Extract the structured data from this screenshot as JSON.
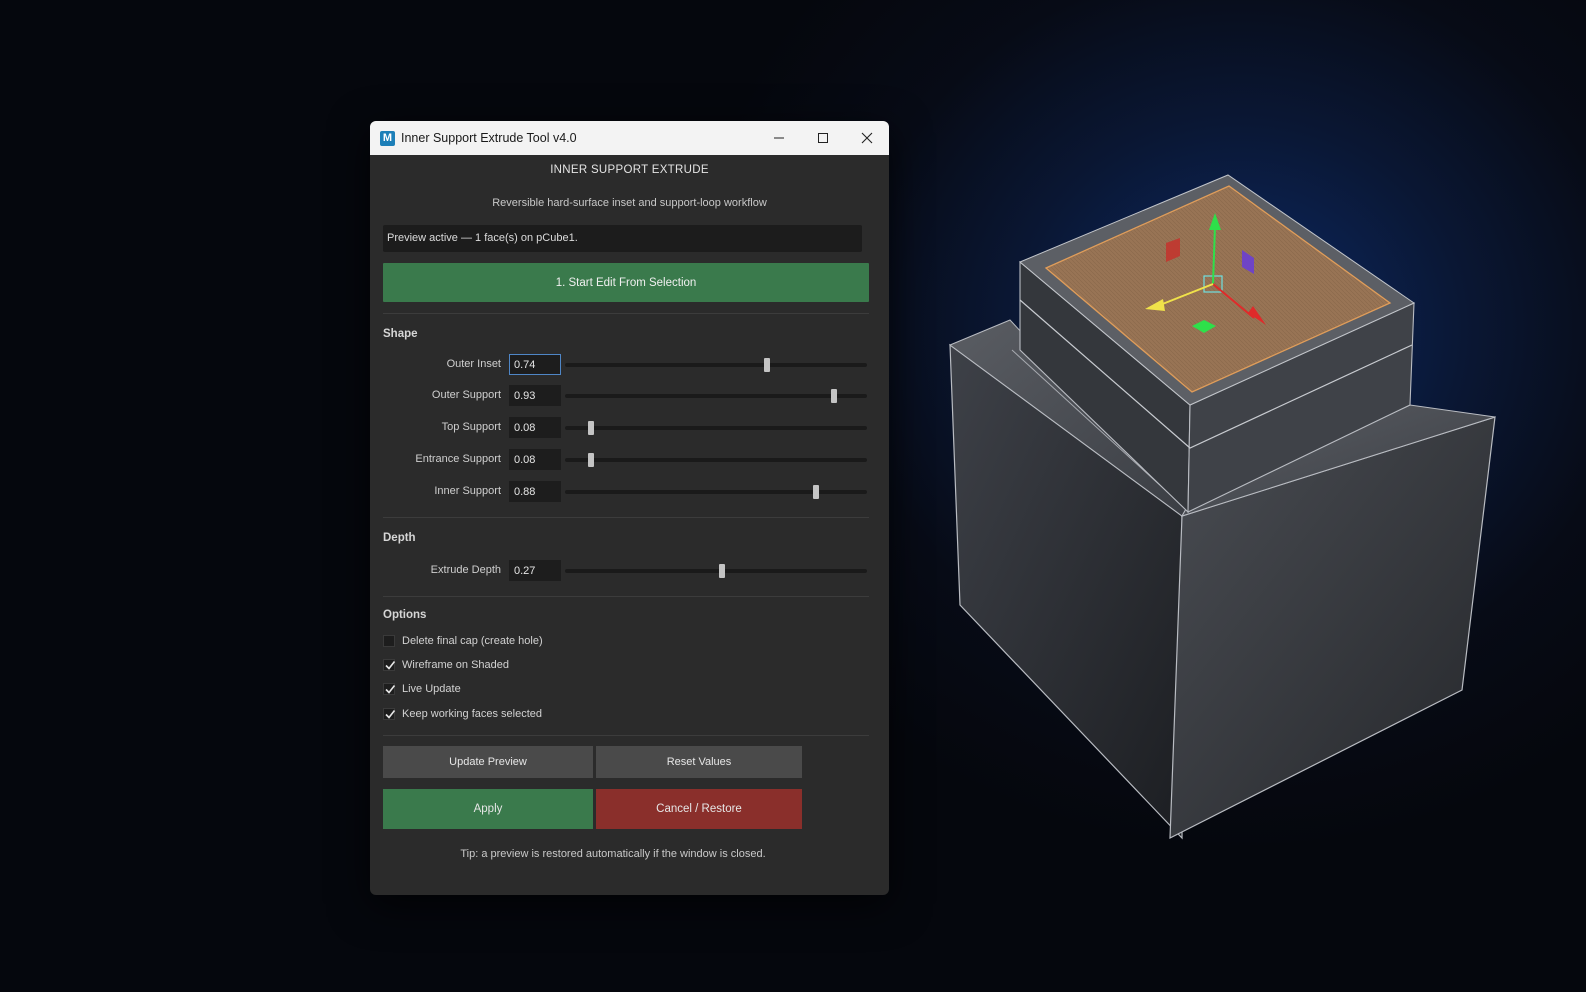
{
  "window": {
    "app_icon_letter": "M",
    "title": "Inner Support Extrude Tool v4.0"
  },
  "header": {
    "title": "INNER SUPPORT EXTRUDE",
    "subtitle": "Reversible hard-surface inset and support-loop workflow"
  },
  "status": "Preview active — 1 face(s) on pCube1.",
  "start_button": "1. Start Edit From Selection",
  "shape": {
    "label": "Shape",
    "params": [
      {
        "label": "Outer Inset",
        "value": "0.74",
        "fraction": 0.67
      },
      {
        "label": "Outer Support",
        "value": "0.93",
        "fraction": 0.89
      },
      {
        "label": "Top Support",
        "value": "0.08",
        "fraction": 0.085
      },
      {
        "label": "Entrance Support",
        "value": "0.08",
        "fraction": 0.085
      },
      {
        "label": "Inner Support",
        "value": "0.88",
        "fraction": 0.83
      }
    ]
  },
  "depth": {
    "label": "Depth",
    "params": [
      {
        "label": "Extrude Depth",
        "value": "0.27",
        "fraction": 0.52
      }
    ]
  },
  "options": {
    "label": "Options",
    "items": [
      {
        "label": "Delete final cap (create hole)",
        "checked": false
      },
      {
        "label": "Wireframe on Shaded",
        "checked": true
      },
      {
        "label": "Live Update",
        "checked": true
      },
      {
        "label": "Keep working faces selected",
        "checked": true
      }
    ]
  },
  "buttons": {
    "update_preview": "Update Preview",
    "reset_values": "Reset Values",
    "apply": "Apply",
    "cancel_restore": "Cancel / Restore"
  },
  "tip": "Tip: a preview is restored automatically if the window is closed.",
  "colors": {
    "accent_green": "#3a7a4c",
    "cancel_red": "#8a2f2b",
    "panel_bg": "#2b2b2b",
    "selected_face": "#9c7655"
  }
}
